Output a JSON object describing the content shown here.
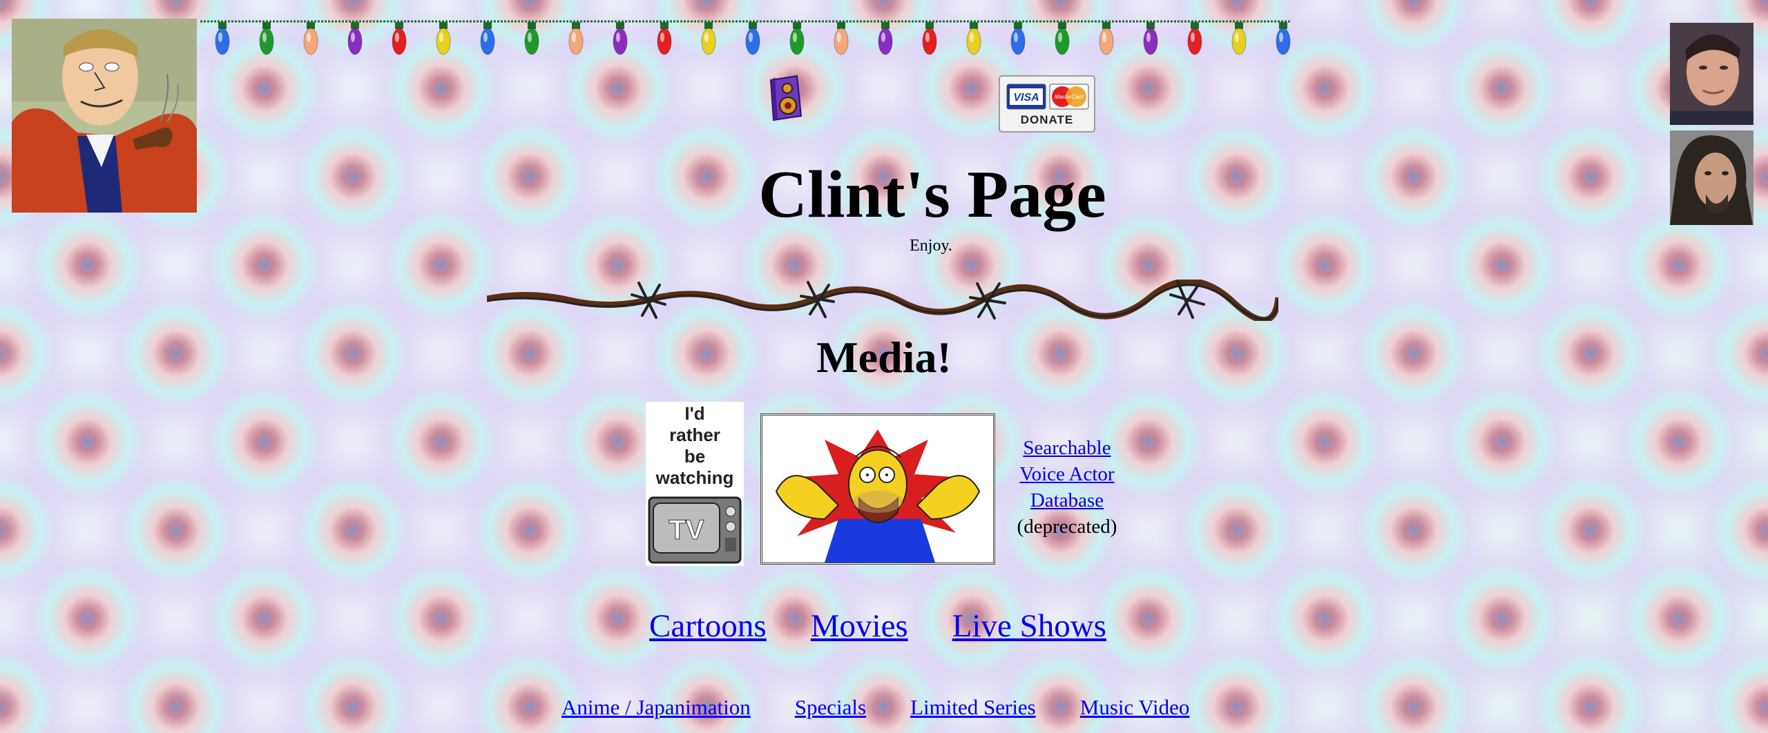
{
  "page": {
    "title": "Clint's Page",
    "subtitle": "Enjoy.",
    "section_heading": "Media!"
  },
  "images": {
    "beavis": "beavis-portrait-image",
    "photo_top_right_1": "portrait-photo",
    "photo_top_right_2": "portrait-photo",
    "speaker": "speaker-icon",
    "donate": "donate-button-image",
    "tv": "tv-badge-image",
    "homer": "homer-simpson-image"
  },
  "donate_badge": {
    "card1": "VISA",
    "card2": "MasterCard",
    "label": "DONATE"
  },
  "tv_badge": {
    "line1": "I'd",
    "line2": "rather",
    "line3": "be",
    "line4": "watching",
    "screen": "TV"
  },
  "voice_db": {
    "link_line1": "Searchable",
    "link_line2": "Voice Actor",
    "link_line3": "Database",
    "note": "(deprecated)"
  },
  "main_links": [
    "Cartoons",
    "Movies",
    "Live Shows"
  ],
  "sub_links": [
    "Anime / Japanimation",
    "Specials",
    "Limited Series",
    "Music Video"
  ],
  "colors": {
    "link": "#0000ee",
    "text": "#000000",
    "light_bulbs": [
      "#2a6fe8",
      "#1f9a2a",
      "#f4a878",
      "#8a2cc0",
      "#e22020",
      "#e8d020"
    ]
  }
}
